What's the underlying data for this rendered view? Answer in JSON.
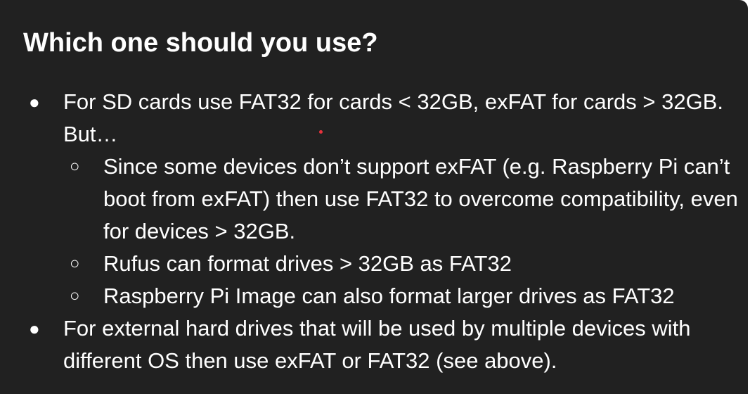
{
  "slide": {
    "title": "Which one should you use?",
    "bullets": [
      {
        "level": 1,
        "marker": "●",
        "text": "For SD cards use FAT32 for cards < 32GB, exFAT for cards > 32GB. But…"
      },
      {
        "level": 2,
        "marker": "○",
        "text": "Since some devices don’t support exFAT (e.g. Raspberry Pi can’t boot from exFAT) then use FAT32 to overcome compatibility, even for devices > 32GB."
      },
      {
        "level": 2,
        "marker": "○",
        "text": "Rufus can format drives > 32GB as FAT32"
      },
      {
        "level": 2,
        "marker": "○",
        "text": "Raspberry Pi Image can also format larger drives as FAT32"
      },
      {
        "level": 1,
        "marker": "●",
        "text": "For external hard drives that will be used by multiple devices with different OS then use exFAT or FAT32 (see above)."
      }
    ]
  },
  "colors": {
    "background": "#212121",
    "text": "#ffffff",
    "pointer": "#e8323c"
  }
}
